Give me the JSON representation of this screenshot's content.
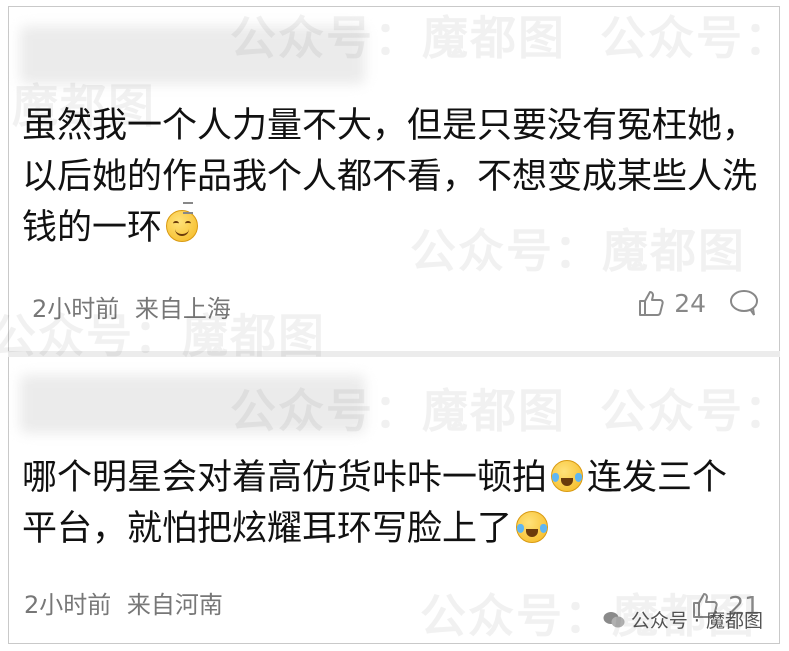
{
  "watermark": {
    "text": "公众号：魔都图"
  },
  "comments": [
    {
      "text_parts": [
        "虽然我一个人力量不大，但是只要没有冤枉她，以后她的作品我个人都不看，不想变成某些人洗钱的一环"
      ],
      "emoji_after": "sweat-smile-emoji",
      "time": "2小时前",
      "location": "来自上海",
      "likes": "24"
    },
    {
      "text_parts": [
        "哪个明星会对着高仿货咔咔一顿拍",
        "连发三个平台，就怕把炫耀耳环写脸上了"
      ],
      "emoji_after": "laugh-cry-emoji",
      "time": "2小时前",
      "location": "来自河南",
      "likes": "21"
    }
  ],
  "footer": {
    "source_label": "公众号 · 魔都图"
  },
  "colors": {
    "meta_gray": "#777777",
    "divider": "#ececec",
    "border": "#c9c9c9"
  }
}
